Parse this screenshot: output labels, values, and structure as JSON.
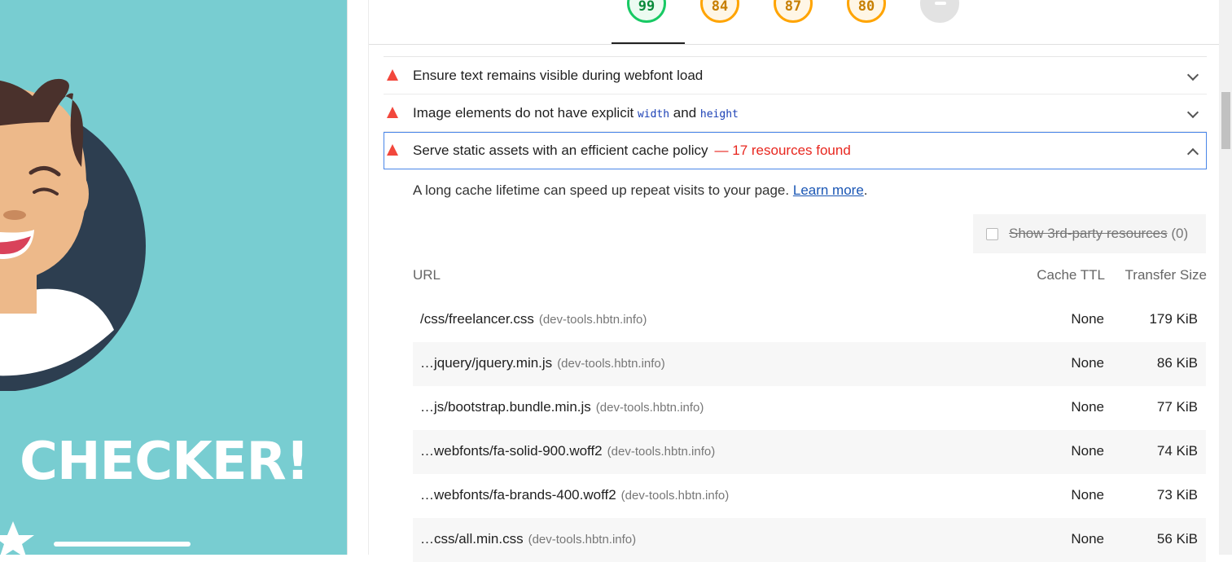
{
  "hero": {
    "title": "E CHECKER!",
    "colors": {
      "background": "#78cdd1",
      "circle": "#2d3e50",
      "skin": "#edb98a",
      "hair": "#4a312c"
    }
  },
  "gauges": [
    {
      "value": "99",
      "status": "pass"
    },
    {
      "value": "84",
      "status": "average"
    },
    {
      "value": "87",
      "status": "average"
    },
    {
      "value": "80",
      "status": "average"
    },
    {
      "value": "",
      "status": "not-applicable"
    }
  ],
  "audits": [
    {
      "icon": "fail-triangle-icon",
      "title": "Ensure text remains visible during webfont load",
      "expanded": false
    },
    {
      "icon": "fail-triangle-icon",
      "title_before": "Image elements do not have explicit ",
      "code1": "width",
      "title_mid": " and ",
      "code2": "height",
      "expanded": false
    },
    {
      "icon": "fail-triangle-icon",
      "title": "Serve static assets with an efficient cache policy",
      "display_value": "— 17 resources found",
      "expanded": true
    }
  ],
  "details": {
    "description": "A long cache lifetime can speed up repeat visits to your page.",
    "learn_more": "Learn more",
    "period": ".",
    "third_party_label": "Show 3rd-party resources",
    "third_party_count": "(0)",
    "third_party_checked": false,
    "columns": {
      "url": "URL",
      "cache_ttl": "Cache TTL",
      "transfer_size": "Transfer Size"
    },
    "rows": [
      {
        "url": "/css/freelancer.css",
        "host": "(dev-tools.hbtn.info)",
        "ttl": "None",
        "size": "179 KiB"
      },
      {
        "url": "…jquery/jquery.min.js",
        "host": "(dev-tools.hbtn.info)",
        "ttl": "None",
        "size": "86 KiB"
      },
      {
        "url": "…js/bootstrap.bundle.min.js",
        "host": "(dev-tools.hbtn.info)",
        "ttl": "None",
        "size": "77 KiB"
      },
      {
        "url": "…webfonts/fa-solid-900.woff2",
        "host": "(dev-tools.hbtn.info)",
        "ttl": "None",
        "size": "74 KiB"
      },
      {
        "url": "…webfonts/fa-brands-400.woff2",
        "host": "(dev-tools.hbtn.info)",
        "ttl": "None",
        "size": "73 KiB"
      },
      {
        "url": "…css/all.min.css",
        "host": "(dev-tools.hbtn.info)",
        "ttl": "None",
        "size": "56 KiB"
      }
    ]
  },
  "colors": {
    "fail": "#f2473c",
    "pass": "#18c964",
    "average": "#ffa400",
    "focus_border": "#4a86e8",
    "link": "#1a56b4"
  }
}
